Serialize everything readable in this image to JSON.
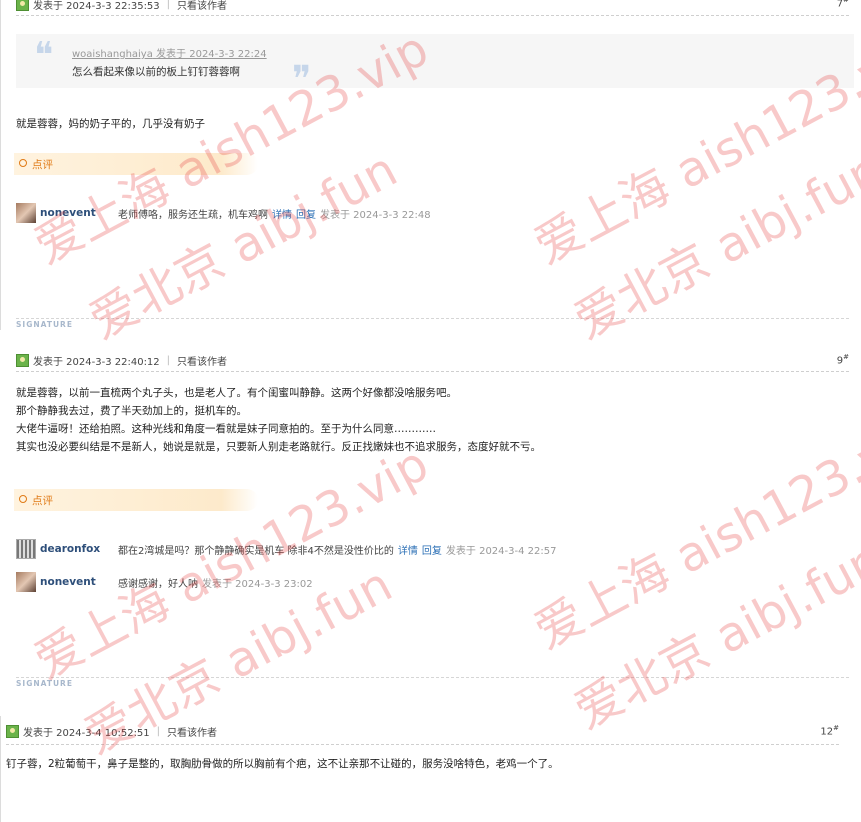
{
  "posts": [
    {
      "time": "发表于 2024-3-3 22:35:53",
      "only_author": "只看该作者",
      "floor": "7",
      "quote": {
        "author": "woaishanghaiya",
        "time": "发表于 2024-3-3 22:24",
        "text": "怎么看起来像以前的板上钉钉蓉蓉啊"
      },
      "body": [
        "就是蓉蓉，妈的奶子平的，几乎没有奶子"
      ],
      "rate_label": "点评",
      "comments": [
        {
          "user": "nonevent",
          "text": "老师傅咯，服务还生疏，机车鸡啊",
          "detail": "详情",
          "reply": "回复",
          "time": "发表于 2024-3-3 22:48"
        }
      ],
      "signature": "SIGNATURE"
    },
    {
      "time": "发表于 2024-3-3 22:40:12",
      "only_author": "只看该作者",
      "floor": "9",
      "body": [
        "就是蓉蓉，以前一直梳两个丸子头，也是老人了。有个闺蜜叫静静。这两个好像都没啥服务吧。",
        "那个静静我去过，费了半天劲加上的，挺机车的。",
        "大佬牛逼呀！还给拍照。这种光线和角度一看就是妹子同意拍的。至于为什么同意…………",
        "其实也没必要纠结是不是新人，她说是就是，只要新人别走老路就行。反正找嫩妹也不追求服务，态度好就不亏。"
      ],
      "rate_label": "点评",
      "comments": [
        {
          "user": "dearonfox",
          "text": "都在2湾城是吗？那个静静确实是机车 除非4不然是没性价比的",
          "detail": "详情",
          "reply": "回复",
          "time": "发表于 2024-3-4 22:57"
        },
        {
          "user": "nonevent",
          "text": "感谢感谢，好人呐",
          "time": "发表于 2024-3-3 23:02"
        }
      ],
      "signature": "SIGNATURE"
    },
    {
      "time": "发表于 2024-3-4 10:52:51",
      "only_author": "只看该作者",
      "floor": "12",
      "body": [
        "钉子蓉，2粒葡萄干，鼻子是整的，取胸肋骨做的所以胸前有个疤，这不让亲那不让碰的，服务没啥特色，老鸡一个了。"
      ]
    }
  ],
  "floor_mark": "#",
  "separator": "|",
  "watermark": {
    "line1": "爱上海 aish123.vip",
    "line2": "爱北京 aibj.fun",
    "color": "#e63c3c"
  },
  "icons": {
    "user": "user-badge-icon",
    "rate": "rate-circle-icon",
    "quote_open": "quote-open-icon",
    "quote_close": "quote-close-icon"
  }
}
